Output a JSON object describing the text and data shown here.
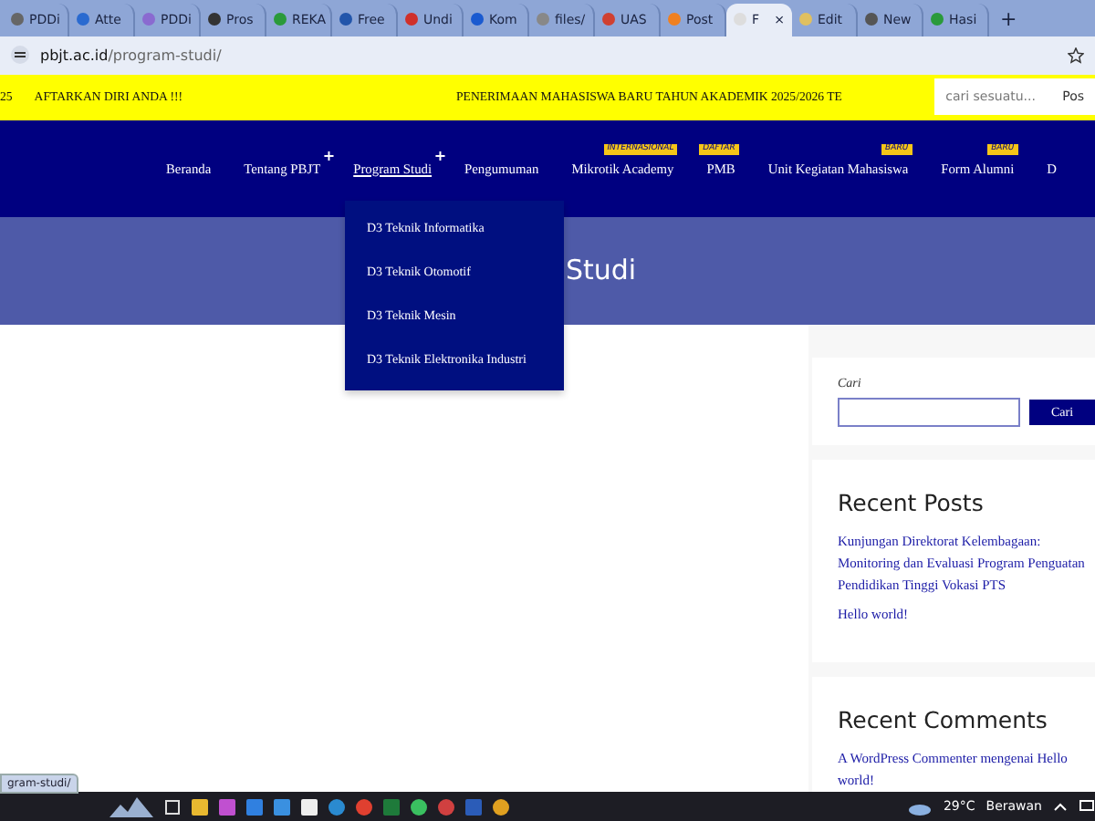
{
  "browser": {
    "tabs": [
      {
        "label": "PDDi",
        "selected": false
      },
      {
        "label": "Atte",
        "selected": false
      },
      {
        "label": "PDDi",
        "selected": false
      },
      {
        "label": "Pros",
        "selected": false
      },
      {
        "label": "REKA",
        "selected": false
      },
      {
        "label": "Free",
        "selected": false
      },
      {
        "label": "Undi",
        "selected": false
      },
      {
        "label": "Kom",
        "selected": false
      },
      {
        "label": "files/",
        "selected": false
      },
      {
        "label": "UAS",
        "selected": false
      },
      {
        "label": "Post",
        "selected": false
      },
      {
        "label": "F",
        "selected": true
      },
      {
        "label": "Edit",
        "selected": false
      },
      {
        "label": "New",
        "selected": false
      },
      {
        "label": "Hasi",
        "selected": false
      }
    ],
    "new_tab": "+",
    "close": "×",
    "url_host": "pbjt.ac.id",
    "url_path": "/program-studi/"
  },
  "announcement_bar": {
    "marquee": [
      "25",
      "AFTARKAN DIRI ANDA !!!",
      "PENERIMAAN MAHASISWA BARU TAHUN AKADEMIK 2025/2026 TE"
    ],
    "search": {
      "placeholder": "cari sesuatu...",
      "button": "Pos"
    }
  },
  "nav": {
    "submenu_mark": "+",
    "items": [
      {
        "label": "Beranda",
        "submenu": false
      },
      {
        "label": "Tentang PBJT",
        "submenu": true
      },
      {
        "label": "Program Studi",
        "submenu": true,
        "expanded": true
      },
      {
        "label": "Pengumuman",
        "submenu": false
      },
      {
        "label": "Mikrotik Academy",
        "submenu": false,
        "badge": "INTERNASIONAL"
      },
      {
        "label": "PMB",
        "submenu": false,
        "badge": "DAFTAR"
      },
      {
        "label": "Unit Kegiatan Mahasiswa",
        "submenu": false,
        "badge": "BARU"
      },
      {
        "label": "Form Alumni",
        "submenu": false,
        "badge": "BARU"
      },
      {
        "label": "D",
        "submenu": false
      }
    ],
    "dropdown": [
      "D3 Teknik Informatika",
      "D3 Teknik Otomotif",
      "D3 Teknik Mesin",
      "D3 Teknik Elektronika Industri"
    ]
  },
  "hero": {
    "title": "Studi"
  },
  "sidebar": {
    "search": {
      "label": "Cari",
      "button": "Cari"
    },
    "recent_posts": {
      "title": "Recent Posts",
      "links": [
        "Kunjungan Direktorat Kelembagaan: Monitoring dan Evaluasi Program Penguatan Pendidikan Tinggi Vokasi PTS",
        "Hello world!"
      ]
    },
    "recent_comments": {
      "title": "Recent Comments",
      "items": [
        "A WordPress Commenter mengenai Hello world!"
      ]
    }
  },
  "status_link": "gram-studi/",
  "taskbar": {
    "temperature": "29°C",
    "weather": "Berawan"
  }
}
